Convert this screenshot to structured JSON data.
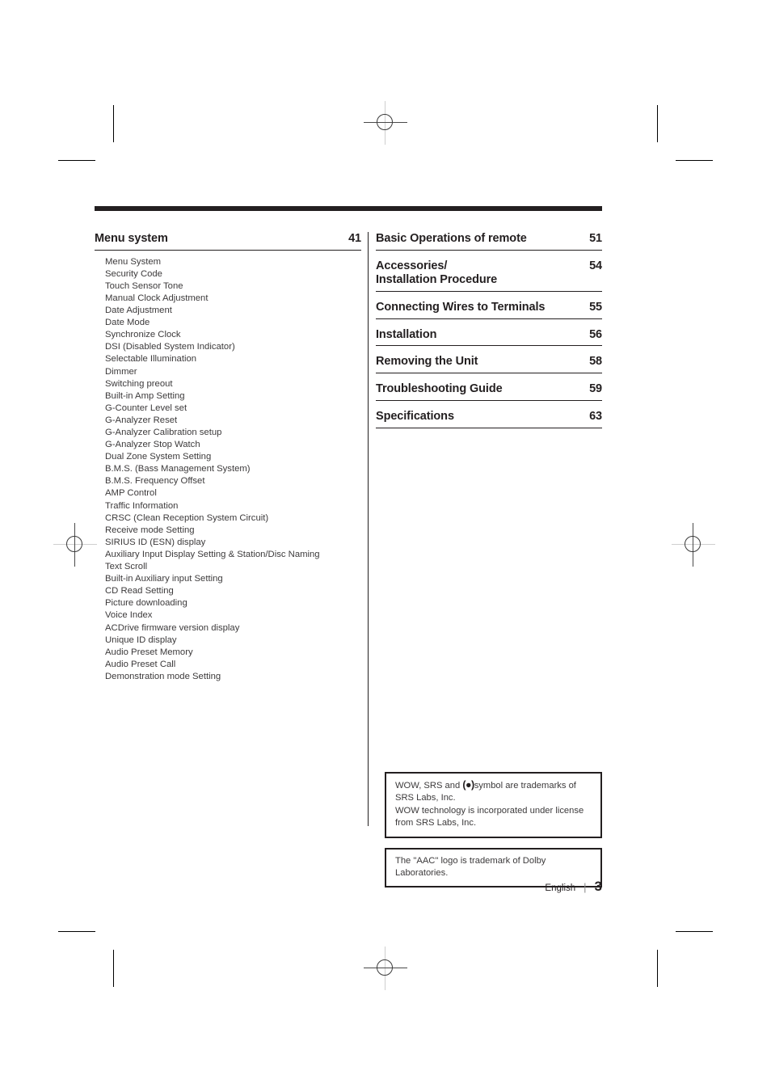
{
  "contents": {
    "left_column": {
      "heading": {
        "title": "Menu system",
        "page": "41"
      },
      "items": [
        "Menu System",
        "Security Code",
        "Touch Sensor Tone",
        "Manual Clock Adjustment",
        "Date Adjustment",
        "Date Mode",
        "Synchronize Clock",
        "DSI (Disabled System Indicator)",
        "Selectable Illumination",
        "Dimmer",
        "Switching preout",
        "Built-in Amp Setting",
        "G-Counter Level set",
        "G-Analyzer Reset",
        "G-Analyzer Calibration setup",
        "G-Analyzer Stop Watch",
        "Dual Zone System Setting",
        "B.M.S. (Bass Management System)",
        "B.M.S. Frequency Offset",
        "AMP Control",
        "Traffic Information",
        "CRSC (Clean Reception System Circuit)",
        "Receive mode Setting",
        "SIRIUS ID (ESN) display",
        "Auxiliary Input Display Setting & Station/Disc Naming",
        "Text Scroll",
        "Built-in Auxiliary input Setting",
        "CD Read Setting",
        "Picture downloading",
        "Voice Index",
        "ACDrive firmware version display",
        "Unique ID display",
        "Audio Preset Memory",
        "Audio Preset Call",
        "Demonstration mode Setting"
      ]
    },
    "right_column": {
      "entries": [
        {
          "title": "Basic Operations of remote",
          "page": "51"
        },
        {
          "title": "Accessories/\nInstallation Procedure",
          "page": "54"
        },
        {
          "title": "Connecting Wires to Terminals",
          "page": "55"
        },
        {
          "title": "Installation",
          "page": "56"
        },
        {
          "title": "Removing the Unit",
          "page": "58"
        },
        {
          "title": "Troubleshooting Guide",
          "page": "59"
        },
        {
          "title": "Specifications",
          "page": "63"
        }
      ]
    }
  },
  "notices": [
    {
      "line1_before": "WOW, SRS and ",
      "symbol": "(●)",
      "line1_after": "symbol are trademarks of",
      "line2": "SRS Labs, Inc.",
      "line3": "WOW technology is incorporated under license",
      "line4": "from SRS Labs, Inc."
    },
    {
      "line1": "The \"AAC\" logo is trademark of Dolby",
      "line2": "Laboratories."
    }
  ],
  "footer": {
    "language": "English",
    "separator": "|",
    "page_number": "3"
  },
  "colors": {
    "ink": "#231f20",
    "body_text": "#3c3a3b"
  }
}
